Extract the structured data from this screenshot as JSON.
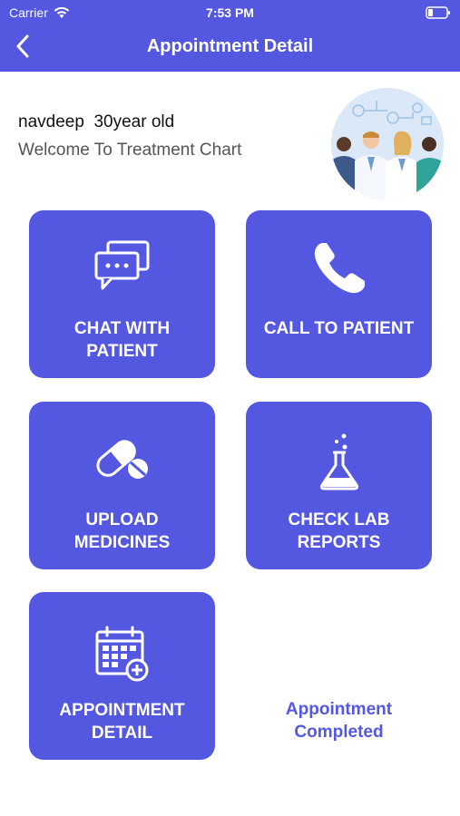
{
  "status": {
    "carrier": "Carrier",
    "time": "7:53 PM"
  },
  "nav": {
    "title": "Appointment Detail"
  },
  "patient": {
    "name": "navdeep  30year old",
    "subtitle": "Welcome To Treatment Chart"
  },
  "tiles": [
    {
      "line1": "CHAT WITH",
      "line2": "PATIENT",
      "icon": "chat-icon"
    },
    {
      "line1": "CALL TO PATIENT",
      "line2": "",
      "icon": "phone-icon"
    },
    {
      "line1": "UPLOAD",
      "line2": "MEDICINES",
      "icon": "pills-icon"
    },
    {
      "line1": "CHECK LAB",
      "line2": "REPORTS",
      "icon": "flask-icon"
    },
    {
      "line1": "APPOINTMENT",
      "line2": "DETAIL",
      "icon": "calendar-add-icon"
    }
  ],
  "completed": {
    "line1": "Appointment",
    "line2": "Completed"
  },
  "colors": {
    "primary": "#5457E0",
    "text": "#111111",
    "subtext": "#555555"
  }
}
